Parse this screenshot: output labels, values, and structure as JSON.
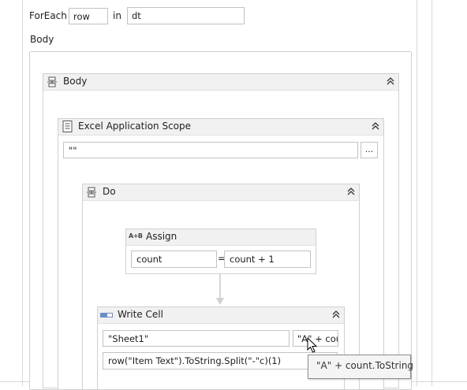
{
  "foreach": {
    "label": "ForEach",
    "item_value": "row",
    "in_label": "in",
    "collection_value": "dt",
    "body_label": "Body"
  },
  "body_seq": {
    "title": "Body",
    "icon": "sequence-icon"
  },
  "excel_scope": {
    "title": "Excel Application Scope",
    "path_value": "\"\"",
    "browse_label": "...",
    "icon": "excel-scope-icon"
  },
  "do_seq": {
    "title": "Do",
    "icon": "sequence-icon"
  },
  "assign": {
    "title": "Assign",
    "icon_text": "A+B",
    "to_value": "count",
    "equals": "=",
    "value": "count + 1"
  },
  "write_cell": {
    "title": "Write Cell",
    "icon": "write-cell-icon",
    "sheet_value": "\"Sheet1\"",
    "range_value": "\"A\" + cou",
    "text_value": "row(\"Item Text\").ToString.Split(\"-\"c)(1)"
  },
  "tooltip": {
    "text": "\"A\" + count.ToString"
  },
  "colors": {
    "header_bg": "#f1f1f1",
    "border": "#d0d0d0",
    "field_border": "#c2c2c2"
  }
}
